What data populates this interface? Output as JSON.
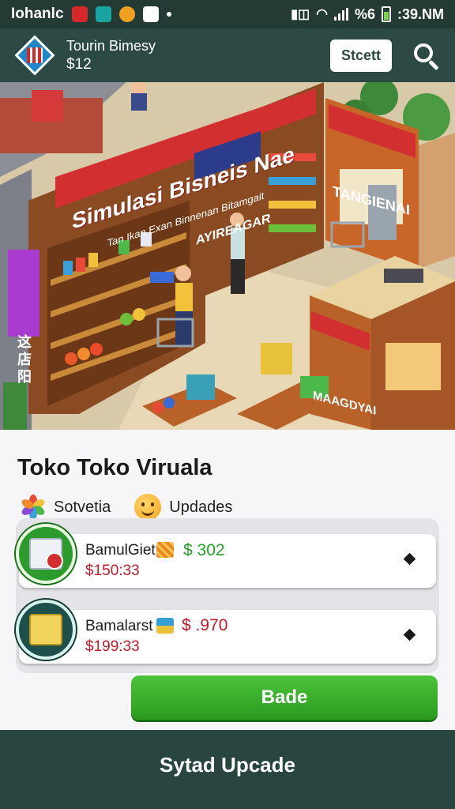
{
  "status_bar": {
    "left_label": "Iohanlc",
    "right_text": "%6",
    "time": ":39.NM"
  },
  "header": {
    "title": "Tourin Bimesy",
    "balance": "$12",
    "start_button": "Stcett",
    "search_icon": "search-icon"
  },
  "scene": {
    "main_sign": "Simulasi Bisneis Nae",
    "sub_sign": "Tan Ikan Exan Binnenan Bitamgait",
    "aisle_sign": "AYIREAGAR",
    "right_sign": "TANGIENAI",
    "counter_sign": "MAAGDYAI",
    "side_sign": "这店阳"
  },
  "panel": {
    "title": "Toko Toko Viruala",
    "tabs": [
      {
        "label": "Sotvetia",
        "icon": "flower-icon"
      },
      {
        "label": "Updades",
        "icon": "smiley-icon"
      }
    ],
    "items": [
      {
        "name": "BamulGiet",
        "price": "$ 302",
        "sub": "$150:33",
        "icon": "document-badge-icon",
        "price_color": "#27a027"
      },
      {
        "name": "Bamalarst",
        "price": "$ .970",
        "sub": "$199:33",
        "icon": "cash-box-icon",
        "price_color": "#c21a2a"
      }
    ],
    "action_button": "Bade"
  },
  "bottom_bar": {
    "label": "Sytad Upcade"
  }
}
